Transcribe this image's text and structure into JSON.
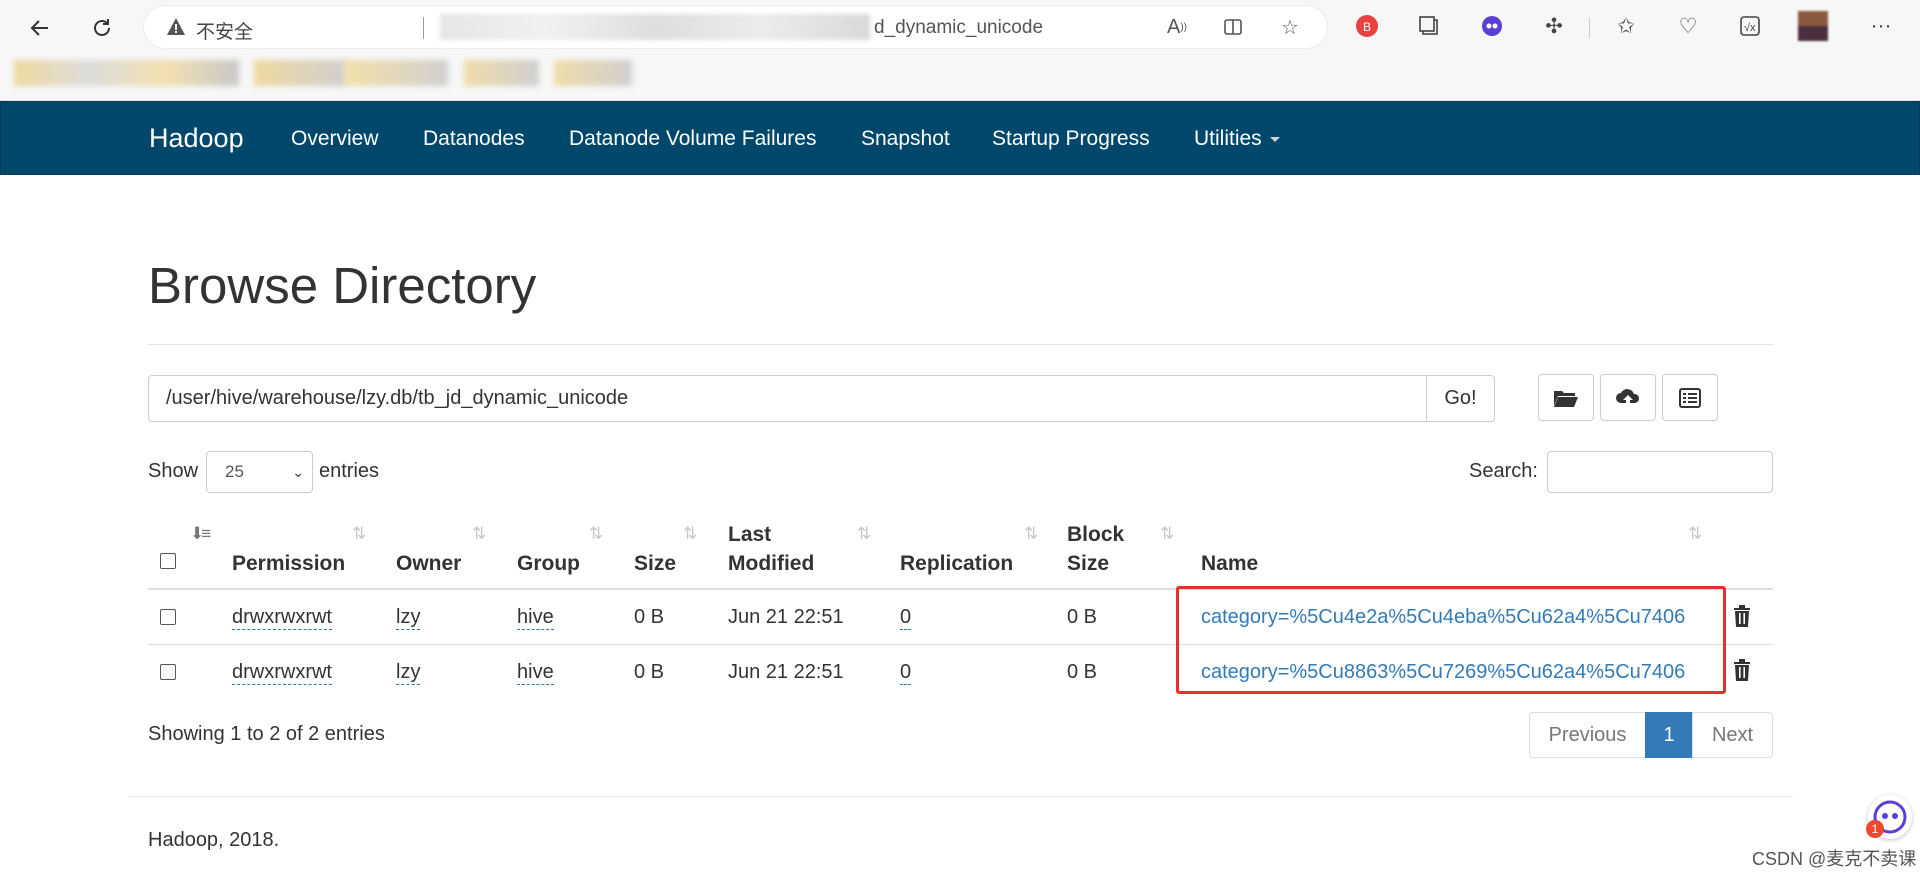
{
  "browser": {
    "insecure_label": "不安全",
    "url_visible": "d_dynamic_unicode"
  },
  "navbar": {
    "brand": "Hadoop",
    "items": [
      "Overview",
      "Datanodes",
      "Datanode Volume Failures",
      "Snapshot",
      "Startup Progress",
      "Utilities"
    ]
  },
  "main": {
    "title": "Browse Directory",
    "path_value": "/user/hive/warehouse/lzy.db/tb_jd_dynamic_unicode",
    "go_label": "Go!",
    "show_label": "Show",
    "entries_label": "entries",
    "page_length": "25",
    "search_label": "Search:",
    "search_value": ""
  },
  "table": {
    "headers": {
      "permission": "Permission",
      "owner": "Owner",
      "group": "Group",
      "size": "Size",
      "last_modified_1": "Last",
      "last_modified_2": "Modified",
      "replication": "Replication",
      "block_size_1": "Block",
      "block_size_2": "Size",
      "name": "Name"
    },
    "rows": [
      {
        "permission": "drwxrwxrwt",
        "owner": "lzy",
        "group": "hive",
        "size": "0 B",
        "last_modified": "Jun 21 22:51",
        "replication": "0",
        "block_size": "0 B",
        "name": "category=%5Cu4e2a%5Cu4eba%5Cu62a4%5Cu7406"
      },
      {
        "permission": "drwxrwxrwt",
        "owner": "lzy",
        "group": "hive",
        "size": "0 B",
        "last_modified": "Jun 21 22:51",
        "replication": "0",
        "block_size": "0 B",
        "name": "category=%5Cu8863%5Cu7269%5Cu62a4%5Cu7406"
      }
    ]
  },
  "pagination": {
    "info": "Showing 1 to 2 of 2 entries",
    "previous": "Previous",
    "current": "1",
    "next": "Next"
  },
  "footer": {
    "text": "Hadoop, 2018."
  },
  "overlay": {
    "watermark": "CSDN @麦克不卖课",
    "assistant_badge": "1",
    "highlight_color": "#e4312b"
  },
  "colors": {
    "navbar": "#00486b",
    "link": "#337ab7",
    "active_page": "#337ab7"
  }
}
